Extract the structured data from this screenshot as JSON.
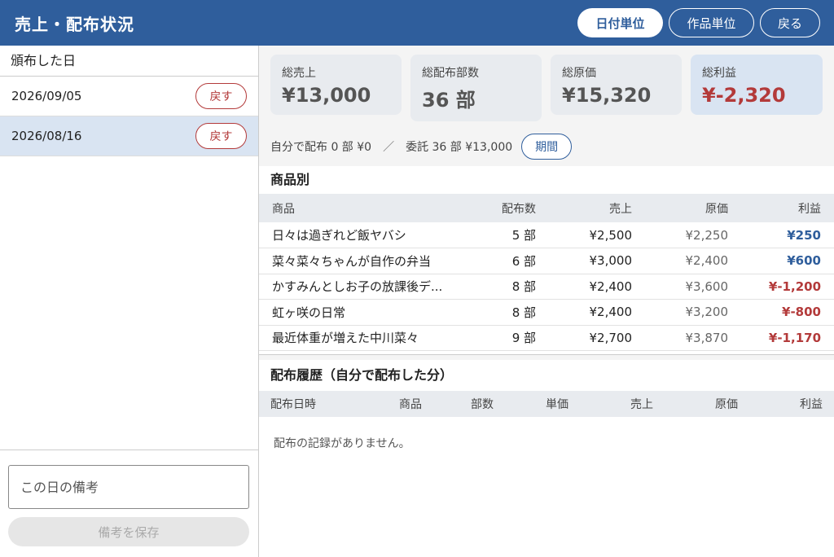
{
  "header": {
    "title": "売上・配布状況",
    "buttons": {
      "by_date": "日付単位",
      "by_work": "作品単位",
      "back": "戻る"
    }
  },
  "sidebar": {
    "heading": "頒布した日",
    "rows": [
      {
        "date": "2026/09/05",
        "action": "戻す",
        "selected": false
      },
      {
        "date": "2026/08/16",
        "action": "戻す",
        "selected": true
      }
    ],
    "memo_placeholder": "この日の備考",
    "save_label": "備考を保存"
  },
  "cards": [
    {
      "label": "総売上",
      "value": "¥13,000"
    },
    {
      "label": "総配布部数",
      "value": "36 部"
    },
    {
      "label": "総原価",
      "value": "¥15,320"
    },
    {
      "label": "総利益",
      "value": "¥-2,320"
    }
  ],
  "summary": {
    "self": "自分で配布 0 部 ¥0",
    "sep": "／",
    "consign": "委託 36 部 ¥13,000",
    "period_label": "期間"
  },
  "products": {
    "title": "商品別",
    "headers": [
      "商品",
      "配布数",
      "売上",
      "原価",
      "利益"
    ],
    "rows": [
      {
        "name": "日々は過ぎれど飯ヤバシ",
        "count": "5 部",
        "sales": "¥2,500",
        "cost": "¥2,250",
        "profit": "¥250",
        "positive": true
      },
      {
        "name": "菜々菜々ちゃんが自作の弁当",
        "count": "6 部",
        "sales": "¥3,000",
        "cost": "¥2,400",
        "profit": "¥600",
        "positive": true
      },
      {
        "name": "かすみんとしお子の放課後デ...",
        "count": "8 部",
        "sales": "¥2,400",
        "cost": "¥3,600",
        "profit": "¥-1,200",
        "positive": false
      },
      {
        "name": "虹ヶ咲の日常",
        "count": "8 部",
        "sales": "¥2,400",
        "cost": "¥3,200",
        "profit": "¥-800",
        "positive": false
      },
      {
        "name": "最近体重が増えた中川菜々",
        "count": "9 部",
        "sales": "¥2,700",
        "cost": "¥3,870",
        "profit": "¥-1,170",
        "positive": false
      }
    ]
  },
  "history": {
    "title": "配布履歴（自分で配布した分）",
    "headers": [
      "配布日時",
      "商品",
      "部数",
      "単価",
      "売上",
      "原価",
      "利益"
    ],
    "empty": "配布の記録がありません。"
  },
  "colors": {
    "header": "#2f5e9c",
    "positive": "#2f5e9c",
    "negative": "#b33a3a",
    "selected_row": "#d9e4f2"
  }
}
